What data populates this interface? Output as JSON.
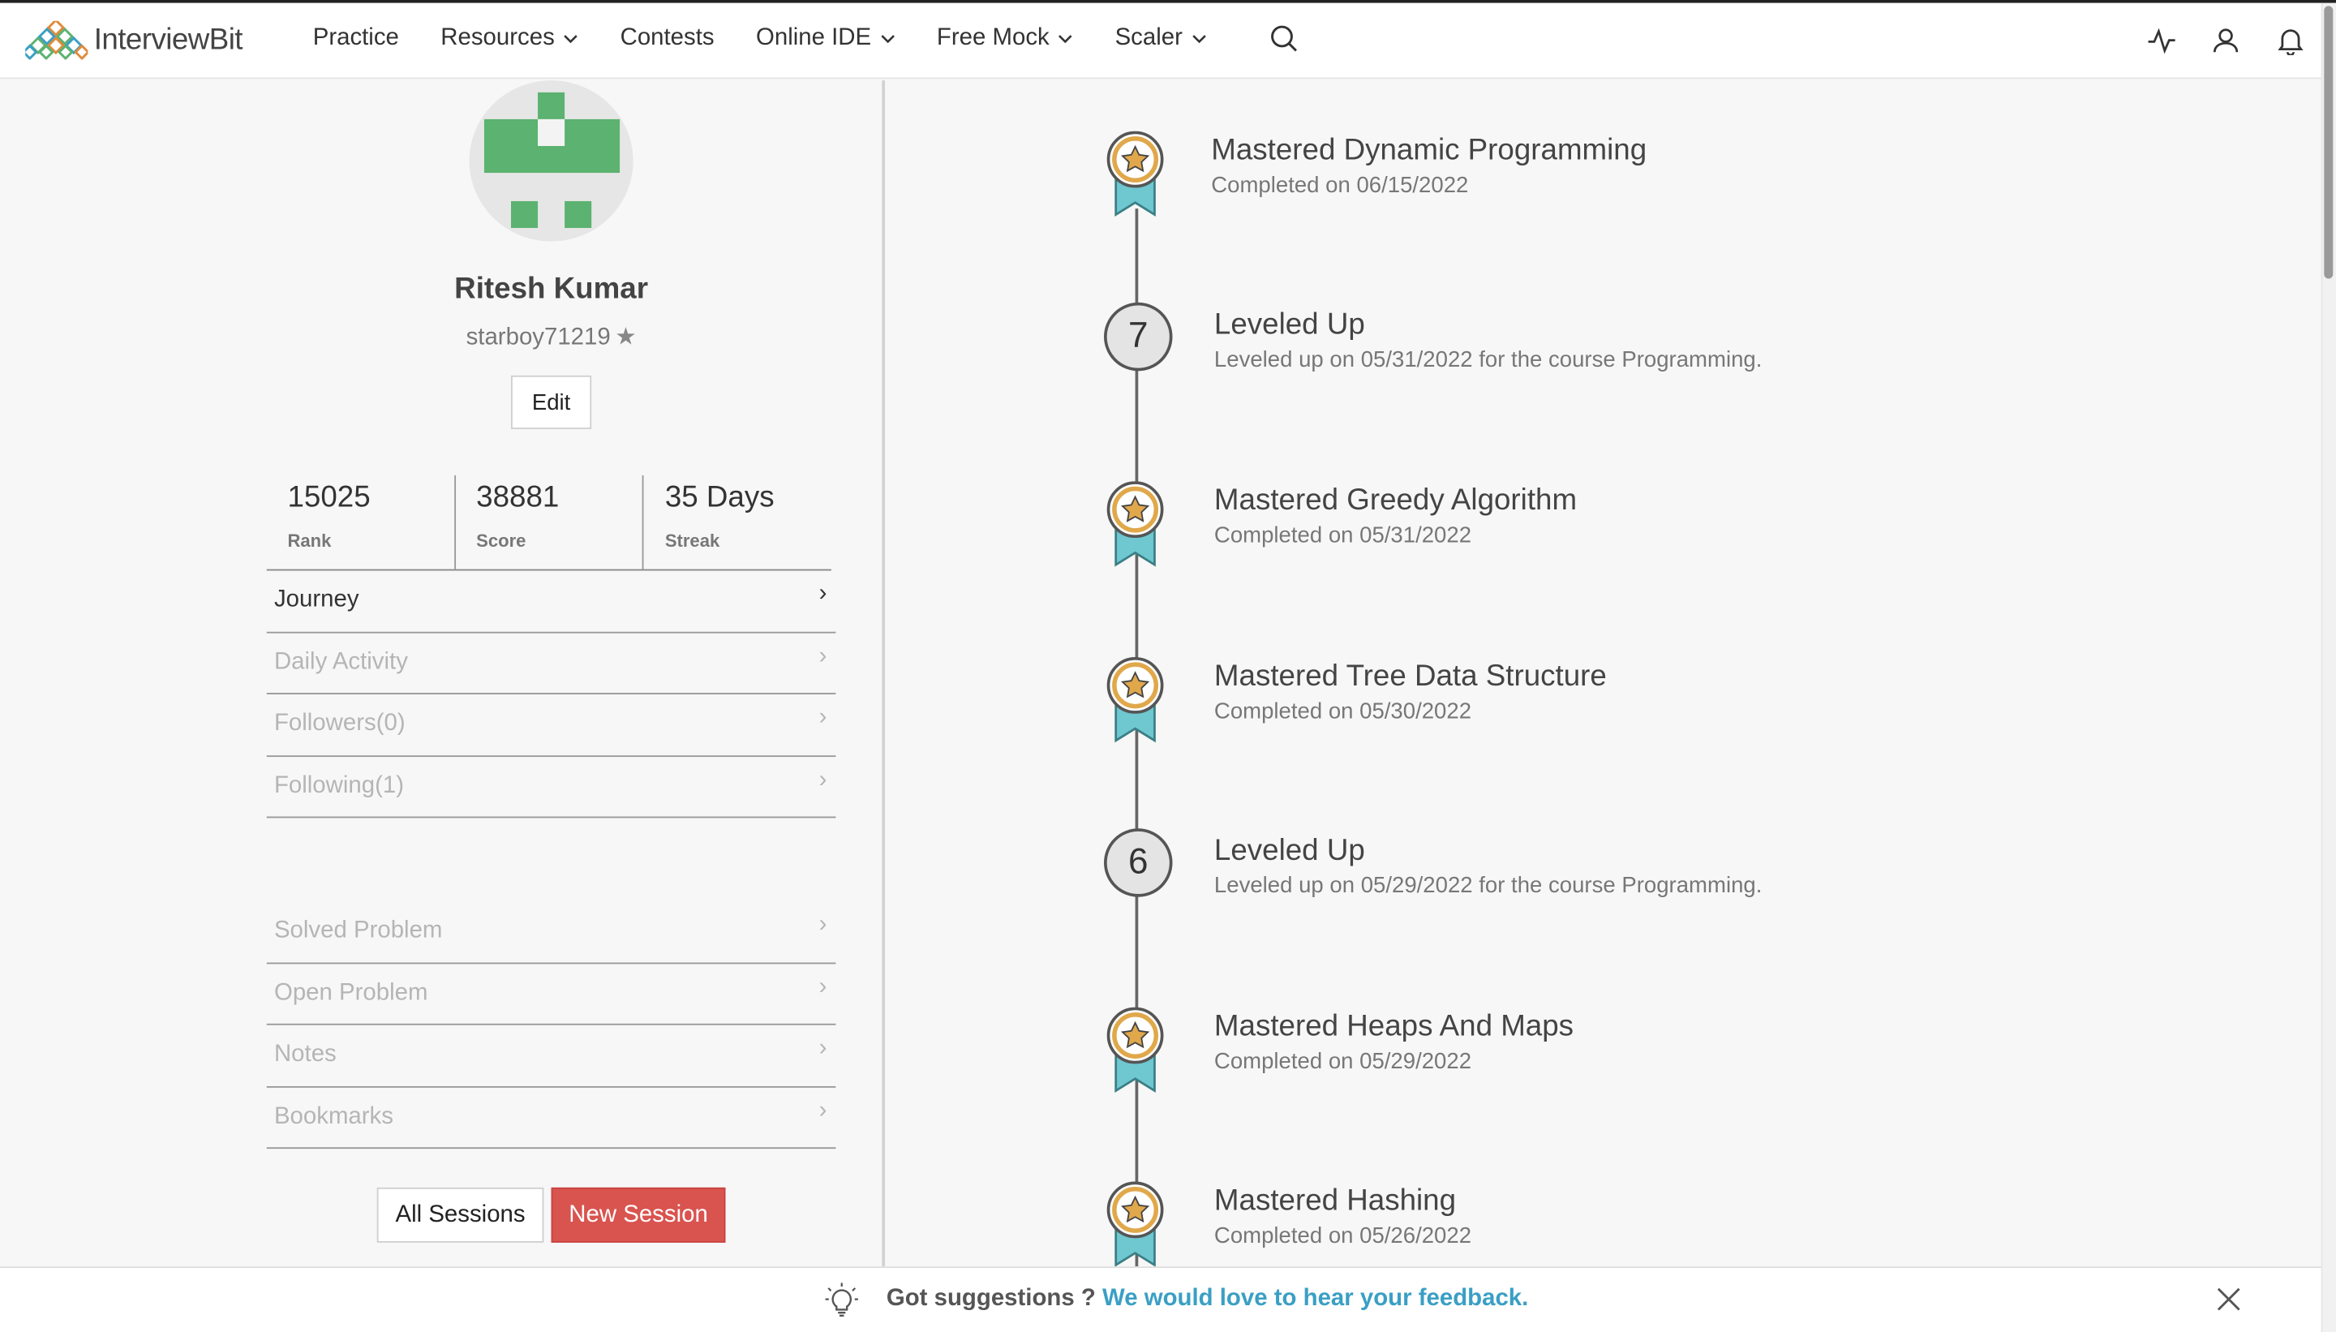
{
  "header": {
    "logo_text": "InterviewBit",
    "nav": [
      {
        "label": "Practice",
        "has_dropdown": false
      },
      {
        "label": "Resources",
        "has_dropdown": true
      },
      {
        "label": "Contests",
        "has_dropdown": false
      },
      {
        "label": "Online IDE",
        "has_dropdown": true
      },
      {
        "label": "Free Mock",
        "has_dropdown": true
      },
      {
        "label": "Scaler",
        "has_dropdown": true
      }
    ],
    "icons": [
      "search-icon",
      "activity-icon",
      "user-icon",
      "bell-icon"
    ]
  },
  "profile": {
    "name": "Ritesh Kumar",
    "username": "starboy71219",
    "username_icon": "star-icon",
    "edit_label": "Edit",
    "stats": [
      {
        "value": "15025",
        "label": "Rank"
      },
      {
        "value": "38881",
        "label": "Score"
      },
      {
        "value": "35 Days",
        "label": "Streak"
      }
    ],
    "menu_primary": [
      "Journey",
      "Daily Activity",
      "Followers(0)",
      "Following(1)"
    ],
    "menu_secondary": [
      "Solved Problem",
      "Open Problem",
      "Notes",
      "Bookmarks"
    ],
    "all_sessions_label": "All Sessions",
    "new_session_label": "New Session"
  },
  "timeline": [
    {
      "kind": "medal",
      "title": "Mastered Dynamic Programming",
      "subtitle": "Completed on 06/15/2022"
    },
    {
      "kind": "level",
      "level": "7",
      "title": "Leveled Up",
      "subtitle": "Leveled up on 05/31/2022 for the course Programming."
    },
    {
      "kind": "medal",
      "title": "Mastered Greedy Algorithm",
      "subtitle": "Completed on 05/31/2022"
    },
    {
      "kind": "medal",
      "title": "Mastered Tree Data Structure",
      "subtitle": "Completed on 05/30/2022"
    },
    {
      "kind": "level",
      "level": "6",
      "title": "Leveled Up",
      "subtitle": "Leveled up on 05/29/2022 for the course Programming."
    },
    {
      "kind": "medal",
      "title": "Mastered Heaps And Maps",
      "subtitle": "Completed on 05/29/2022"
    },
    {
      "kind": "medal",
      "title": "Mastered Hashing",
      "subtitle": "Completed on 05/26/2022"
    }
  ],
  "feedback": {
    "prompt": "Got suggestions ?",
    "link": "We would love to hear your feedback."
  },
  "colors": {
    "avatar_green": "#5cb270",
    "new_session_red": "#d9534f",
    "feedback_link": "#3a9fc4",
    "ribbon_teal": "#6fc7d0",
    "medal_gold": "#e0a84b"
  }
}
